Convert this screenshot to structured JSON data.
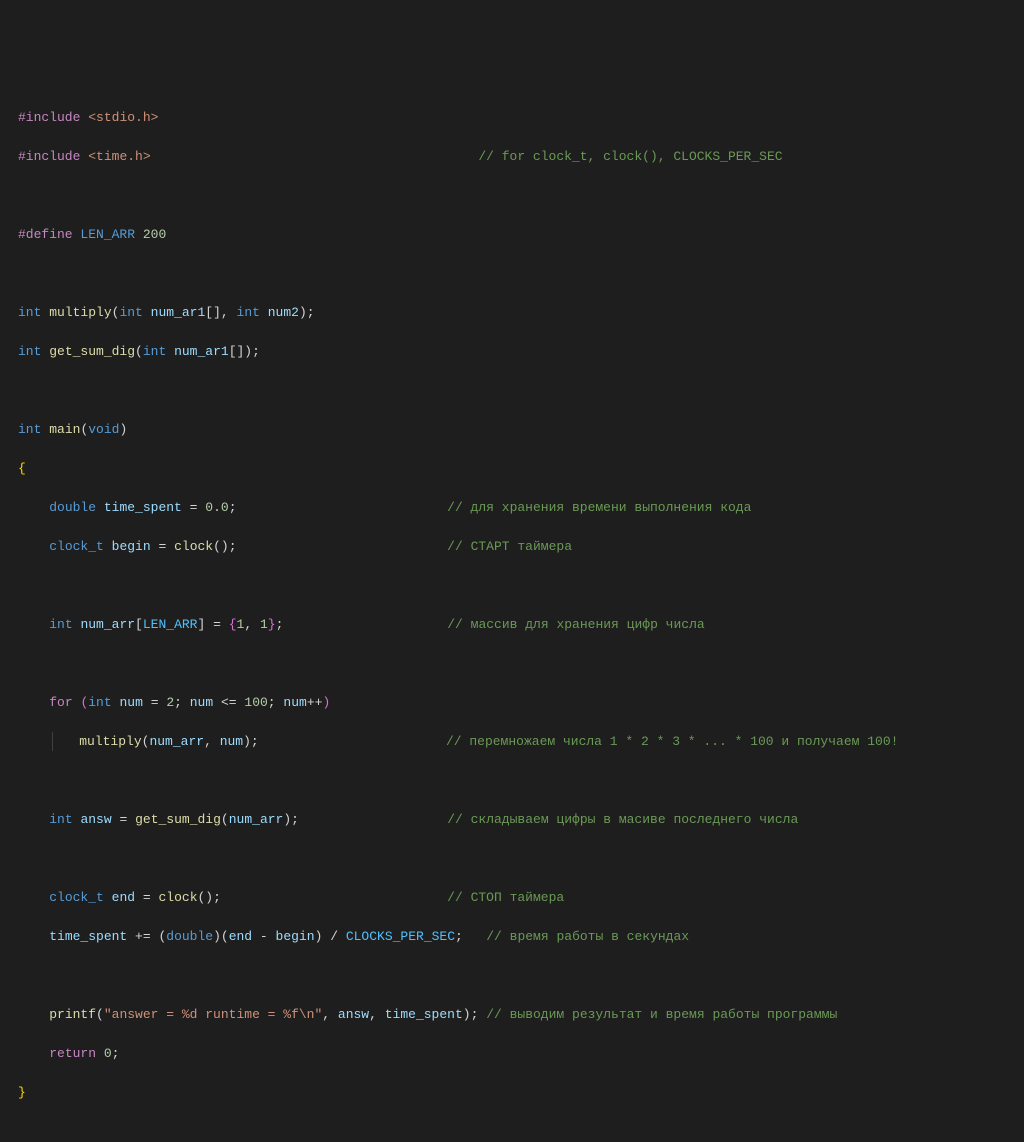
{
  "code": {
    "line1": {
      "include": "#include",
      "lib": "<stdio.h>"
    },
    "line2": {
      "include": "#include",
      "lib": "<time.h>",
      "comment": "// for clock_t, clock(), CLOCKS_PER_SEC"
    },
    "line4": {
      "define": "#define",
      "name": "LEN_ARR",
      "value": "200"
    },
    "line6": {
      "type1": "int",
      "func": "multiply",
      "type2": "int",
      "param1": "num_ar1",
      "type3": "int",
      "param2": "num2"
    },
    "line7": {
      "type1": "int",
      "func": "get_sum_dig",
      "type2": "int",
      "param1": "num_ar1"
    },
    "line9": {
      "type1": "int",
      "func": "main",
      "type2": "void"
    },
    "line11": {
      "type": "double",
      "var": "time_spent",
      "val": "0.0",
      "comment": "// для хранения времени выполнения кода"
    },
    "line12": {
      "type": "clock_t",
      "var": "begin",
      "func": "clock",
      "comment": "// СТАРТ таймера"
    },
    "line14": {
      "type": "int",
      "var": "num_arr",
      "const": "LEN_ARR",
      "v1": "1",
      "v2": "1",
      "comment": "// массив для хранения цифр числа"
    },
    "line16": {
      "for": "for",
      "type": "int",
      "var": "num",
      "v1": "2",
      "v2": "100"
    },
    "line17": {
      "func": "multiply",
      "arg1": "num_arr",
      "arg2": "num",
      "comment": "// перемножаем числа 1 * 2 * 3 * ... * 100 и получаем 100!"
    },
    "line19": {
      "type": "int",
      "var": "answ",
      "func": "get_sum_dig",
      "arg": "num_arr",
      "comment": "// складываем цифры в масиве последнего числа"
    },
    "line21": {
      "type": "clock_t",
      "var": "end",
      "func": "clock",
      "comment": "// СТОП таймера"
    },
    "line22": {
      "var1": "time_spent",
      "cast": "double",
      "var2": "end",
      "var3": "begin",
      "const": "CLOCKS_PER_SEC",
      "comment": "// время работы в секундах"
    },
    "line24": {
      "func": "printf",
      "str": "\"answer = %d runtime = %f\\n\"",
      "arg1": "answ",
      "arg2": "time_spent",
      "comment": "// выводим результат и время работы программы"
    },
    "line25": {
      "ret": "return",
      "val": "0"
    }
  }
}
